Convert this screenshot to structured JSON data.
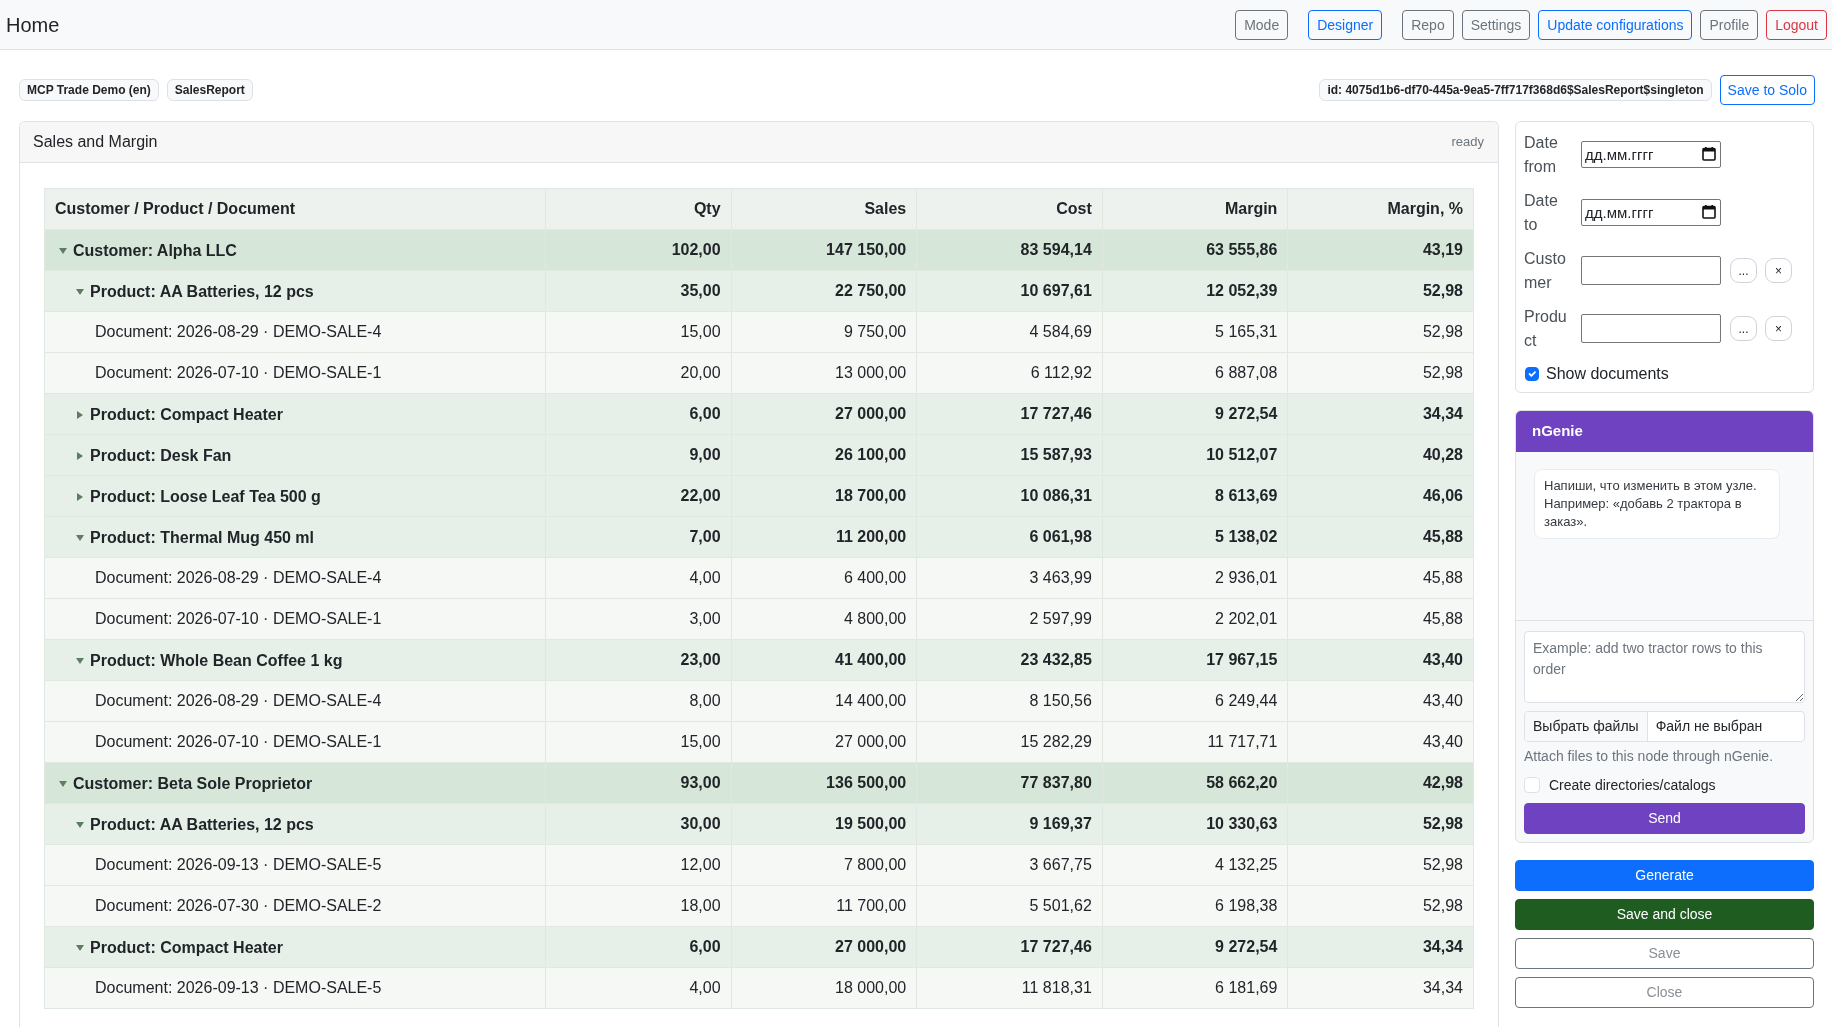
{
  "header": {
    "title": "Home",
    "button_groups": [
      [
        "Mode"
      ],
      [
        "Designer"
      ],
      [
        "Repo",
        "Settings",
        "Update configurations",
        "Profile",
        "Logout"
      ]
    ]
  },
  "context": {
    "tags": [
      "MCP Trade Demo (en)",
      "SalesReport"
    ],
    "id_tag": "id: 4075d1b6-df70-445a-9ea5-7ff717f368d6$SalesReport$singleton",
    "save_button": "Save to Solo"
  },
  "report": {
    "title": "Sales and Margin",
    "status": "ready",
    "table": {
      "columns": [
        "Customer / Product / Document",
        "Qty",
        "Sales",
        "Cost",
        "Margin",
        "Margin, %"
      ],
      "rows": [
        {
          "kind": "customer",
          "label": "Customer: Alpha LLC",
          "expanded": true,
          "values": [
            "102,00",
            "147 150,00",
            "83 594,14",
            "63 555,86",
            "43,19"
          ],
          "children": [
            {
              "kind": "product",
              "label": "Product: AA Batteries, 12 pcs",
              "expanded": true,
              "values": [
                "35,00",
                "22 750,00",
                "10 697,61",
                "12 052,39",
                "52,98"
              ],
              "children": [
                {
                  "kind": "document",
                  "label": "Document: 2026-08-29 · DEMO-SALE-4",
                  "values": [
                    "15,00",
                    "9 750,00",
                    "4 584,69",
                    "5 165,31",
                    "52,98"
                  ]
                },
                {
                  "kind": "document",
                  "label": "Document: 2026-07-10 · DEMO-SALE-1",
                  "values": [
                    "20,00",
                    "13 000,00",
                    "6 112,92",
                    "6 887,08",
                    "52,98"
                  ]
                }
              ]
            },
            {
              "kind": "product",
              "label": "Product: Compact Heater",
              "expanded": false,
              "values": [
                "6,00",
                "27 000,00",
                "17 727,46",
                "9 272,54",
                "34,34"
              ]
            },
            {
              "kind": "product",
              "label": "Product: Desk Fan",
              "expanded": false,
              "values": [
                "9,00",
                "26 100,00",
                "15 587,93",
                "10 512,07",
                "40,28"
              ]
            },
            {
              "kind": "product",
              "label": "Product: Loose Leaf Tea 500 g",
              "expanded": false,
              "values": [
                "22,00",
                "18 700,00",
                "10 086,31",
                "8 613,69",
                "46,06"
              ]
            },
            {
              "kind": "product",
              "label": "Product: Thermal Mug 450 ml",
              "expanded": true,
              "values": [
                "7,00",
                "11 200,00",
                "6 061,98",
                "5 138,02",
                "45,88"
              ],
              "children": [
                {
                  "kind": "document",
                  "label": "Document: 2026-08-29 · DEMO-SALE-4",
                  "values": [
                    "4,00",
                    "6 400,00",
                    "3 463,99",
                    "2 936,01",
                    "45,88"
                  ]
                },
                {
                  "kind": "document",
                  "label": "Document: 2026-07-10 · DEMO-SALE-1",
                  "values": [
                    "3,00",
                    "4 800,00",
                    "2 597,99",
                    "2 202,01",
                    "45,88"
                  ]
                }
              ]
            },
            {
              "kind": "product",
              "label": "Product: Whole Bean Coffee 1 kg",
              "expanded": true,
              "values": [
                "23,00",
                "41 400,00",
                "23 432,85",
                "17 967,15",
                "43,40"
              ],
              "children": [
                {
                  "kind": "document",
                  "label": "Document: 2026-08-29 · DEMO-SALE-4",
                  "values": [
                    "8,00",
                    "14 400,00",
                    "8 150,56",
                    "6 249,44",
                    "43,40"
                  ]
                },
                {
                  "kind": "document",
                  "label": "Document: 2026-07-10 · DEMO-SALE-1",
                  "values": [
                    "15,00",
                    "27 000,00",
                    "15 282,29",
                    "11 717,71",
                    "43,40"
                  ]
                }
              ]
            }
          ]
        },
        {
          "kind": "customer",
          "label": "Customer: Beta Sole Proprietor",
          "expanded": true,
          "values": [
            "93,00",
            "136 500,00",
            "77 837,80",
            "58 662,20",
            "42,98"
          ],
          "children": [
            {
              "kind": "product",
              "label": "Product: AA Batteries, 12 pcs",
              "expanded": true,
              "values": [
                "30,00",
                "19 500,00",
                "9 169,37",
                "10 330,63",
                "52,98"
              ],
              "children": [
                {
                  "kind": "document",
                  "label": "Document: 2026-09-13 · DEMO-SALE-5",
                  "values": [
                    "12,00",
                    "7 800,00",
                    "3 667,75",
                    "4 132,25",
                    "52,98"
                  ]
                },
                {
                  "kind": "document",
                  "label": "Document: 2026-07-30 · DEMO-SALE-2",
                  "values": [
                    "18,00",
                    "11 700,00",
                    "5 501,62",
                    "6 198,38",
                    "52,98"
                  ]
                }
              ]
            },
            {
              "kind": "product",
              "label": "Product: Compact Heater",
              "expanded": true,
              "values": [
                "6,00",
                "27 000,00",
                "17 727,46",
                "9 272,54",
                "34,34"
              ],
              "children": [
                {
                  "kind": "document",
                  "label": "Document: 2026-09-13 · DEMO-SALE-5",
                  "values": [
                    "4,00",
                    "18 000,00",
                    "11 818,31",
                    "6 181,69",
                    "34,34"
                  ]
                }
              ]
            }
          ]
        }
      ]
    }
  },
  "filters": {
    "fields": [
      {
        "kind": "date",
        "label": "Date from",
        "placeholder": "дд.мм.гггг"
      },
      {
        "kind": "date",
        "label": "Date to",
        "placeholder": "дд.мм.гггг"
      },
      {
        "kind": "lookup",
        "label": "Customer",
        "browse": "...",
        "clear": "×"
      },
      {
        "kind": "lookup",
        "label": "Product",
        "browse": "...",
        "clear": "×"
      }
    ],
    "show_documents": {
      "label": "Show documents",
      "checked": true
    }
  },
  "ngenie": {
    "title": "nGenie",
    "messages": [
      "Напиши, что изменить в этом узле. Например: «добавь 2 трактора в заказ»."
    ],
    "input": {
      "placeholder": "Example: add two tractor rows to this order"
    },
    "file_button": "Выбрать файлы",
    "file_status": "Файл не выбран",
    "hint": "Attach files to this node through nGenie.",
    "create_catalogs": {
      "label": "Create directories/catalogs",
      "checked": false
    },
    "send_button": "Send"
  },
  "actions": [
    "Generate",
    "Save and close",
    "Save",
    "Close"
  ]
}
